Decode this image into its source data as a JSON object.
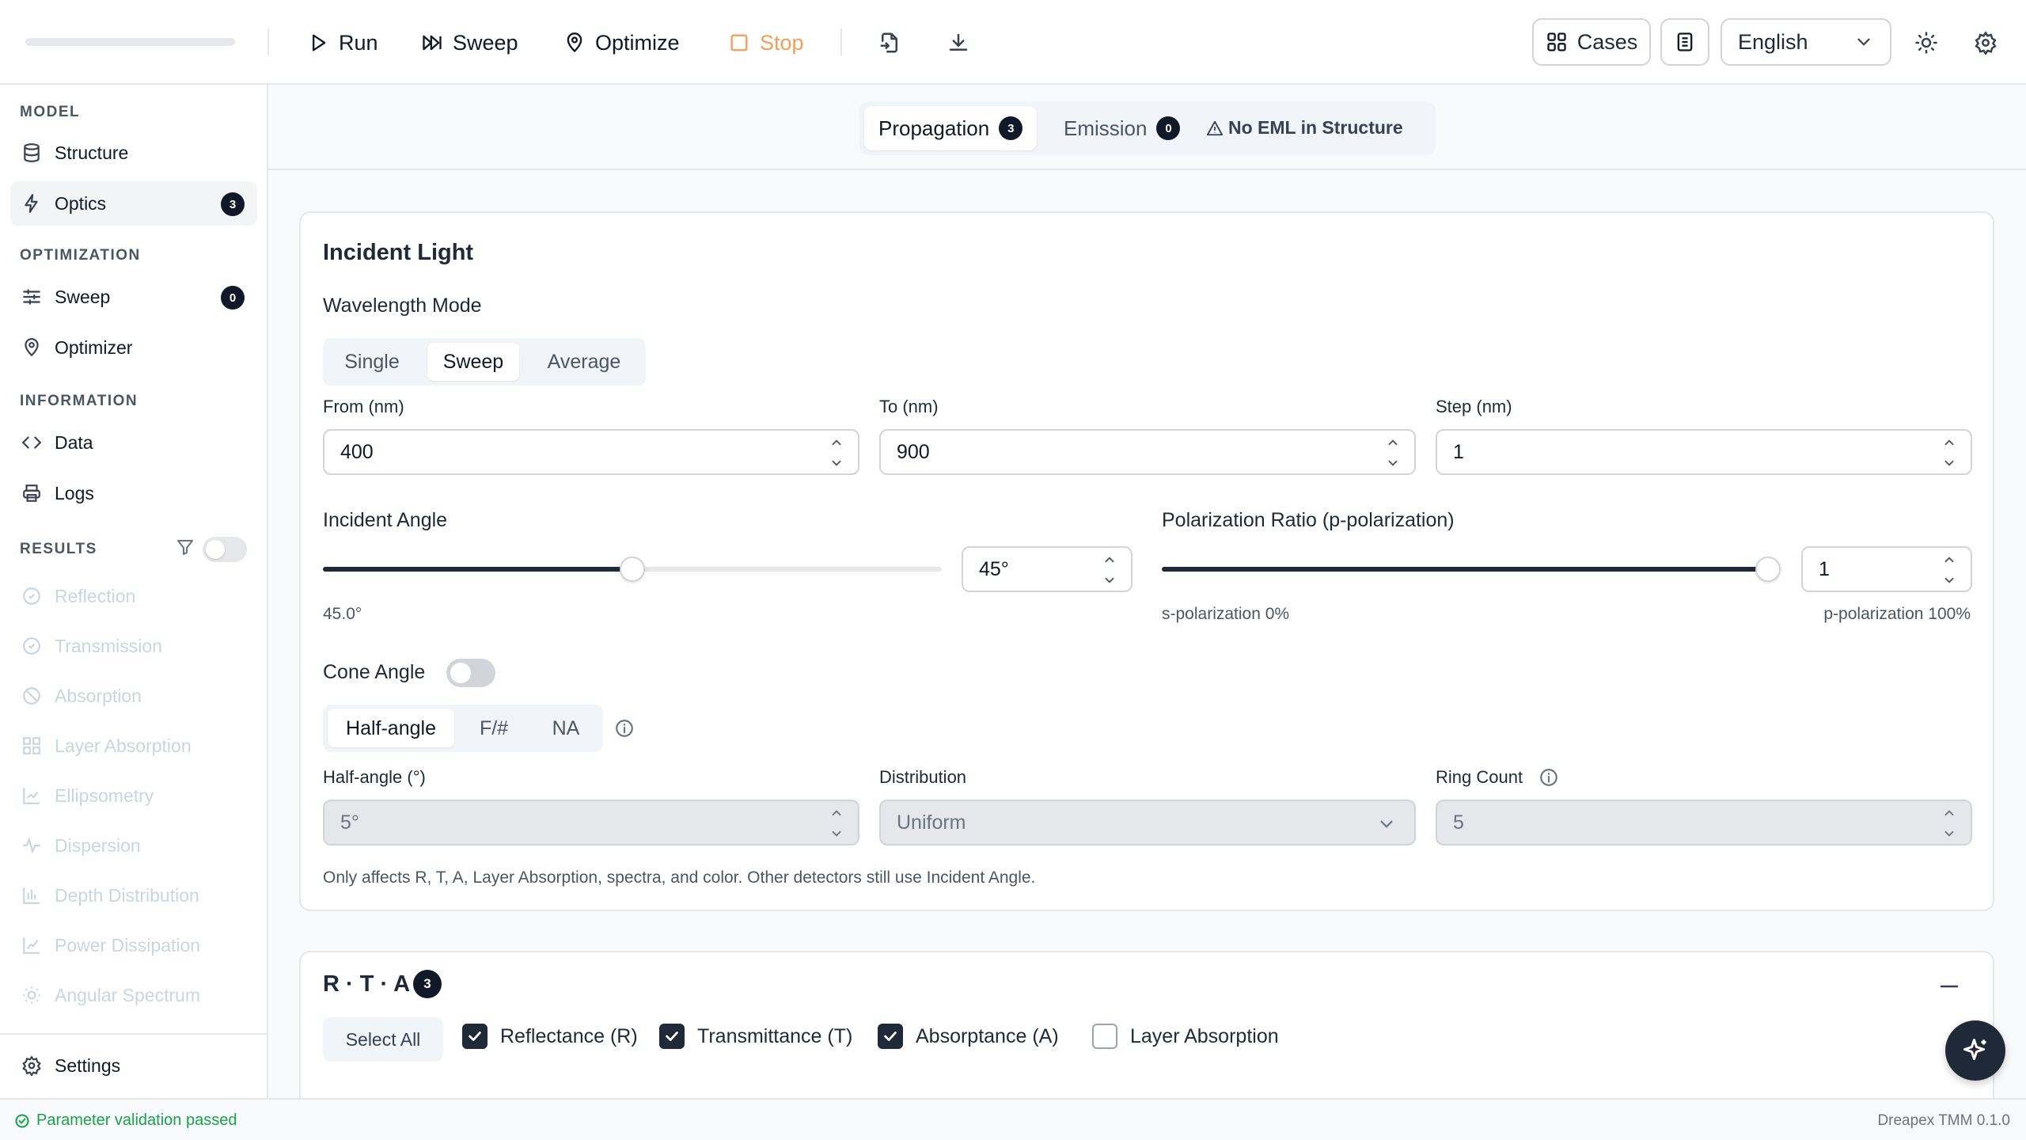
{
  "toolbar": {
    "run_label": "Run",
    "sweep_label": "Sweep",
    "optimize_label": "Optimize",
    "stop_label": "Stop",
    "cases_label": "Cases",
    "language": "English"
  },
  "sidebar": {
    "sections": {
      "model": "MODEL",
      "optimization": "OPTIMIZATION",
      "information": "INFORMATION",
      "results": "RESULTS"
    },
    "model_items": [
      {
        "label": "Structure",
        "icon": "database-icon"
      },
      {
        "label": "Optics",
        "icon": "bolt-icon",
        "badge": "3"
      }
    ],
    "optimization_items": [
      {
        "label": "Sweep",
        "icon": "sliders-icon",
        "badge": "0"
      },
      {
        "label": "Optimizer",
        "icon": "location-pin-icon"
      }
    ],
    "information_items": [
      {
        "label": "Data",
        "icon": "code-icon"
      },
      {
        "label": "Logs",
        "icon": "printer-icon"
      }
    ],
    "results_items": [
      {
        "label": "Reflection"
      },
      {
        "label": "Transmission"
      },
      {
        "label": "Absorption"
      },
      {
        "label": "Layer Absorption"
      },
      {
        "label": "Ellipsometry"
      },
      {
        "label": "Dispersion"
      },
      {
        "label": "Depth Distribution"
      },
      {
        "label": "Power Dissipation"
      },
      {
        "label": "Angular Spectrum"
      }
    ],
    "settings_label": "Settings"
  },
  "tabs": {
    "propagation": {
      "label": "Propagation",
      "badge": "3"
    },
    "emission": {
      "label": "Emission",
      "badge": "0"
    },
    "warning": "No EML in Structure"
  },
  "incident_light": {
    "title": "Incident Light",
    "wavelength_mode_label": "Wavelength Mode",
    "modes": [
      "Single",
      "Sweep",
      "Average"
    ],
    "selected_mode": "Sweep",
    "from_label": "From (nm)",
    "from_value": "400",
    "to_label": "To (nm)",
    "to_value": "900",
    "step_label": "Step (nm)",
    "step_value": "1",
    "angle_label": "Incident Angle",
    "angle_input": "45°",
    "angle_readout": "45.0°",
    "angle_fraction": 0.5,
    "polarization_label": "Polarization Ratio (p-polarization)",
    "polarization_input": "1",
    "polarization_fraction": 1.0,
    "s_pol_hint": "s-polarization 0%",
    "p_pol_hint": "p-polarization 100%",
    "cone_label": "Cone Angle",
    "cone_enabled": false,
    "cone_modes": [
      "Half-angle",
      "F/#",
      "NA"
    ],
    "half_angle_label": "Half-angle (°)",
    "half_angle_value": "5°",
    "distribution_label": "Distribution",
    "distribution_value": "Uniform",
    "ring_count_label": "Ring Count",
    "ring_count_value": "5",
    "note": "Only affects R, T, A, Layer Absorption, spectra, and color. Other detectors still use Incident Angle."
  },
  "rta": {
    "title": "R · T · A",
    "badge": "3",
    "select_all": "Select All",
    "options": [
      {
        "label": "Reflectance (R)",
        "checked": true
      },
      {
        "label": "Transmittance (T)",
        "checked": true
      },
      {
        "label": "Absorptance (A)",
        "checked": true
      },
      {
        "label": "Layer Absorption",
        "checked": false
      }
    ]
  },
  "status": {
    "message": "Parameter validation passed",
    "version": "Dreapex TMM 0.1.0"
  },
  "colors": {
    "accent_dark": "#1f2937",
    "stop": "#f59e57",
    "success": "#16a34a",
    "disabled": "#cbd5e1"
  }
}
